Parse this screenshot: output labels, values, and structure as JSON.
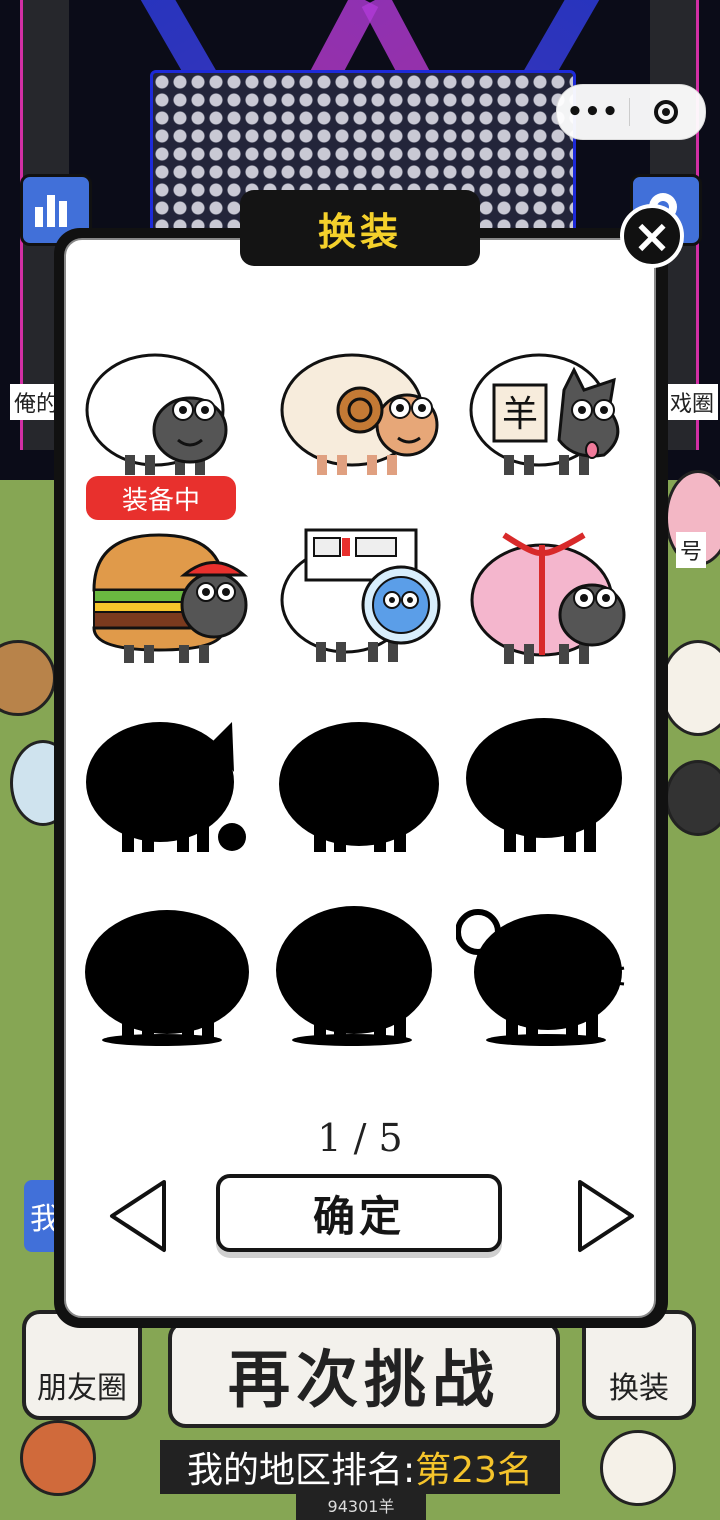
{
  "top_bar": {
    "more_icon": "ellipsis-icon",
    "close_icon": "target-circle-icon"
  },
  "background": {
    "left_side_label": "俺的",
    "right_side_label": "戏圈",
    "right_side_label_2": "号",
    "left_bottom_button": "朋友圈",
    "center_button": "再次挑战",
    "right_bottom_button": "换装",
    "left_mid_label": "我",
    "rank_prefix": "我的地区排名:",
    "rank_value": "第23名",
    "sheep_count": "94301羊"
  },
  "modal": {
    "title": "换装",
    "close_label": "×",
    "equipped_label": "装备中",
    "page_indicator": "1 / 5",
    "confirm_label": "确定",
    "skins": [
      {
        "type": "classic",
        "unlocked": true,
        "equipped": true
      },
      {
        "type": "ram",
        "unlocked": true,
        "equipped": false,
        "sign_text": ""
      },
      {
        "type": "wolf",
        "unlocked": true,
        "equipped": false,
        "sign_text": "羊"
      },
      {
        "type": "burger",
        "unlocked": true,
        "equipped": false
      },
      {
        "type": "astronaut",
        "unlocked": true,
        "equipped": false
      },
      {
        "type": "pink-gift",
        "unlocked": true,
        "equipped": false
      },
      {
        "type": "locked",
        "unlocked": false
      },
      {
        "type": "locked",
        "unlocked": false
      },
      {
        "type": "locked",
        "unlocked": false
      },
      {
        "type": "locked",
        "unlocked": false
      },
      {
        "type": "locked",
        "unlocked": false
      },
      {
        "type": "locked",
        "unlocked": false
      }
    ]
  },
  "colors": {
    "title_text": "#f5d12b",
    "equipped_badge": "#e8302d",
    "rank_highlight": "#f5c42b"
  }
}
